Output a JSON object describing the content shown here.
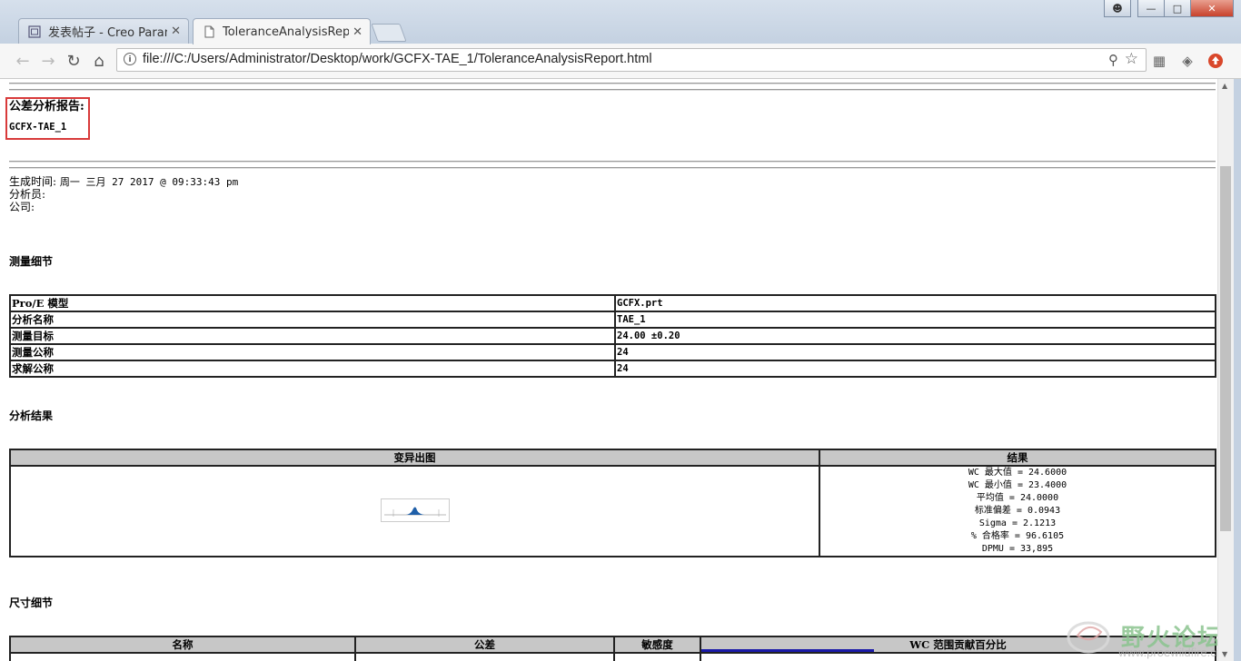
{
  "browser": {
    "tabs": [
      {
        "title": "发表帖子 - Creo Parame",
        "icon": "page-icon"
      },
      {
        "title": "ToleranceAnalysisRepc",
        "icon": "document-icon"
      }
    ],
    "url": "file:///C:/Users/Administrator/Desktop/work/GCFX-TAE_1/ToleranceAnalysisReport.html"
  },
  "report": {
    "title": "公差分析报告:",
    "model": "GCFX-TAE_1",
    "generated_label": "生成时间:",
    "generated_value": "周一 三月 27 2017 @ 09:33:43 pm",
    "analyst_label": "分析员:",
    "company_label": "公司:",
    "measure_section": "测量细节",
    "details": [
      {
        "label": "Pro/E 模型",
        "value": "GCFX.prt"
      },
      {
        "label": "分析名称",
        "value": "TAE_1"
      },
      {
        "label": "测量目标",
        "value": "24.00 ±0.20"
      },
      {
        "label": "测量公称",
        "value": "24"
      },
      {
        "label": "求解公称",
        "value": "24"
      }
    ],
    "results_section": "分析结果",
    "results_headers": [
      "变异出图",
      "结果"
    ],
    "results_lines": [
      "WC 最大值 = 24.6000",
      "WC 最小值 = 23.4000",
      "平均值 = 24.0000",
      "标准偏差 = 0.0943",
      "Sigma = 2.1213",
      "% 合格率 = 96.6105",
      "DPMU = 33,895"
    ],
    "dims_section": "尺寸细节",
    "dims_headers": [
      "名称",
      "公差",
      "敏感度",
      "WC 范围贡献百分比"
    ]
  },
  "watermark": {
    "text": "野火论坛",
    "url": "www.proewildfire.cn"
  },
  "colors": {
    "red_box": "#d83a3a",
    "bar_blue": "#1a1aa8",
    "header_gray": "#c7c7c7"
  }
}
